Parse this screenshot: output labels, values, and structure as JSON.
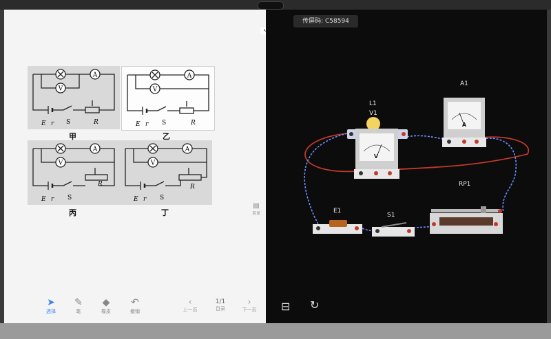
{
  "whiteboard": {
    "diagram_labels": {
      "A": "A",
      "V": "V",
      "E": "E",
      "r": "r",
      "S": "S",
      "R": "R"
    },
    "diagram_captions": [
      "甲",
      "乙",
      "丙",
      "丁"
    ],
    "tools": [
      {
        "label": "选择",
        "icon": "cursor-icon"
      },
      {
        "label": "笔",
        "icon": "pen-icon"
      },
      {
        "label": "橡皮",
        "icon": "eraser-icon"
      },
      {
        "label": "撤销",
        "icon": "undo-icon"
      }
    ],
    "pager": {
      "page": "1/1",
      "prev_label": "上一页",
      "next_label": "下一页",
      "menu_label": "目录"
    },
    "side_button_label": "目录"
  },
  "simulator": {
    "cast_code": "传屏码: C58594",
    "components": {
      "bulb": "L1",
      "voltmeter": "V1",
      "ammeter": "A1",
      "rheostat": "RP1",
      "battery": "E1",
      "switch": "S1"
    },
    "meter_glyphs": {
      "voltmeter": "V",
      "ammeter": "A"
    }
  },
  "colors": {
    "wire_red": "#c0392b",
    "wire_blue": "#6f8cff",
    "active_tool": "#3b82f6"
  }
}
